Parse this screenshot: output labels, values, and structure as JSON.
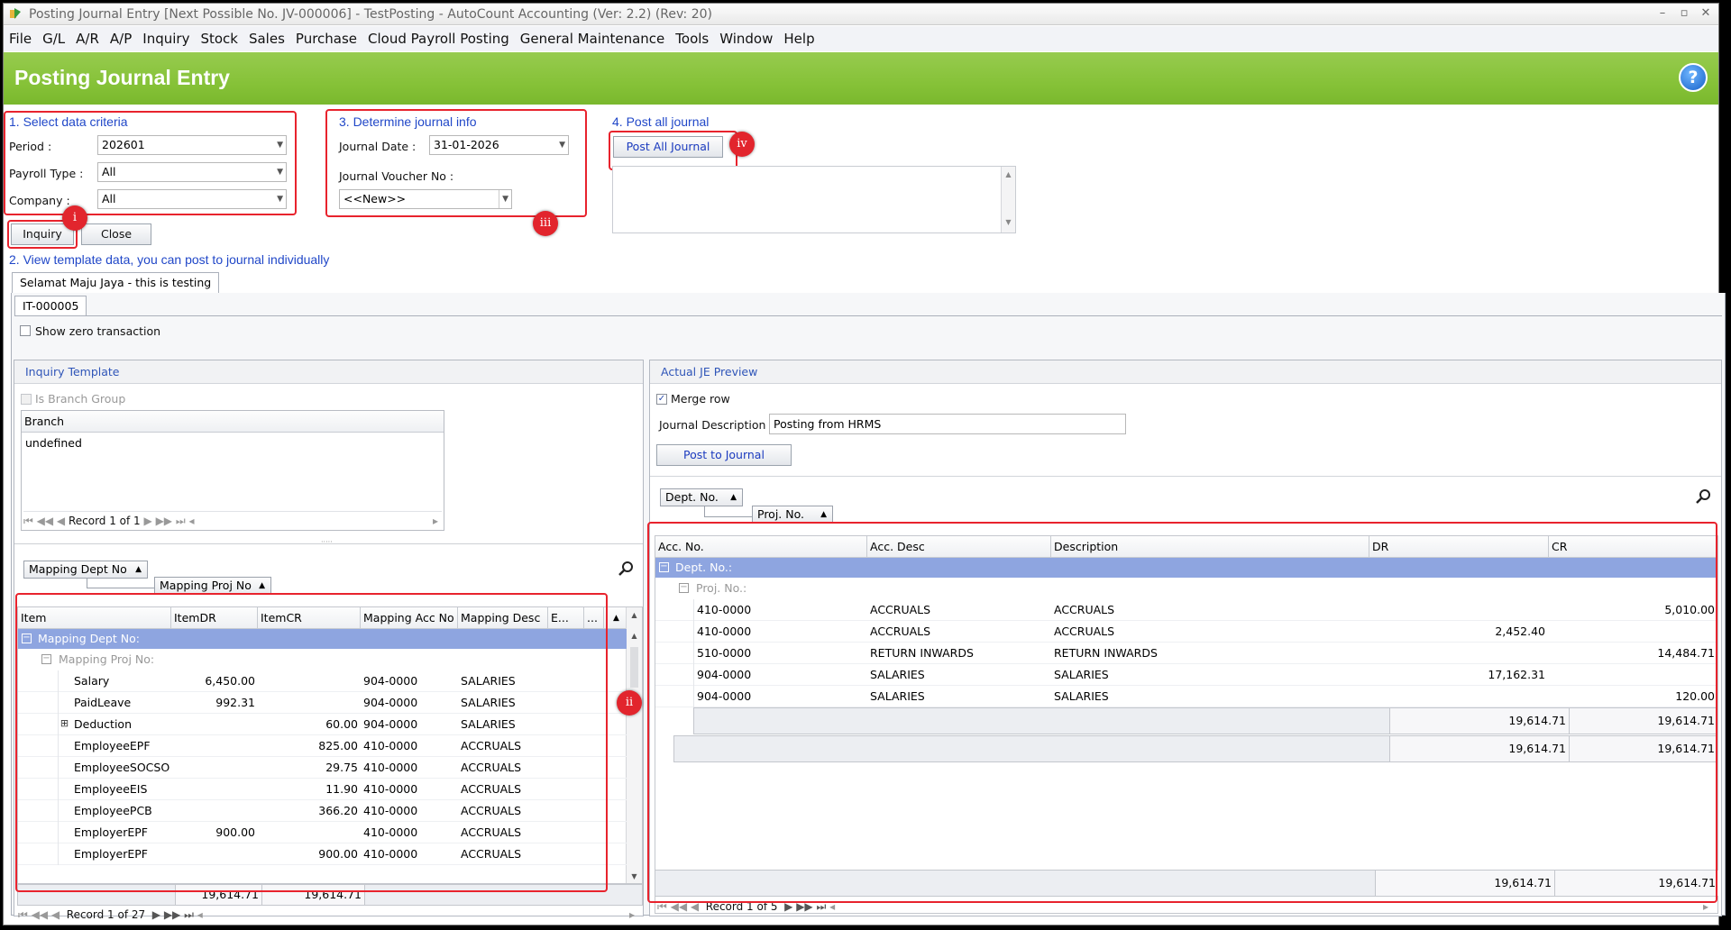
{
  "window": {
    "title": "Posting Journal Entry [Next Possible No. JV-000006] - TestPosting - AutoCount Accounting (Ver: 2.2) (Rev: 20)"
  },
  "menu": [
    "File",
    "G/L",
    "A/R",
    "A/P",
    "Inquiry",
    "Stock",
    "Sales",
    "Purchase",
    "Cloud Payroll Posting",
    "General Maintenance",
    "Tools",
    "Window",
    "Help"
  ],
  "banner": {
    "title": "Posting Journal Entry",
    "help": "?"
  },
  "step1": {
    "title": "1. Select data criteria",
    "period_label": "Period :",
    "period": "202601",
    "payroll_label": "Payroll Type :",
    "payroll": "All",
    "company_label": "Company :",
    "company": "All",
    "inquiry": "Inquiry",
    "close": "Close"
  },
  "step3": {
    "title": "3. Determine journal info",
    "date_label": "Journal Date :",
    "date": "31-01-2026",
    "voucher_label": "Journal Voucher No :",
    "voucher": "<<New>>"
  },
  "step4": {
    "title": "4. Post all journal",
    "post_all": "Post All Journal"
  },
  "step2": {
    "title": "2. View template data, you can post to journal individually"
  },
  "badges": {
    "i": "i",
    "ii": "ii",
    "iii": "iii",
    "iv": "iv"
  },
  "tabs": {
    "company_tab": "Selamat Maju Jaya - this is testing",
    "doc_tab": "IT-000005"
  },
  "show_zero": "Show zero transaction",
  "inquiry_template": {
    "title": "Inquiry Template",
    "is_branch": "Is Branch Group",
    "branch_header": "Branch",
    "branch_value": "undefined",
    "record": "Record 1 of 1"
  },
  "mapping": {
    "chip_dept": "Mapping Dept No",
    "chip_proj": "Mapping Proj No",
    "headers": [
      "Item",
      "ItemDR",
      "ItemCR",
      "Mapping Acc No",
      "Mapping Desc",
      "E...",
      "..."
    ],
    "group1": "Mapping Dept No:",
    "group2": "Mapping Proj No:",
    "rows": [
      {
        "item": "Salary",
        "dr": "6,450.00",
        "cr": "",
        "acc": "904-0000",
        "desc": "SALARIES"
      },
      {
        "item": "PaidLeave",
        "dr": "992.31",
        "cr": "",
        "acc": "904-0000",
        "desc": "SALARIES"
      },
      {
        "item": "Deduction",
        "dr": "",
        "cr": "60.00",
        "acc": "904-0000",
        "desc": "SALARIES",
        "expand": "+"
      },
      {
        "item": "EmployeeEPF",
        "dr": "",
        "cr": "825.00",
        "acc": "410-0000",
        "desc": "ACCRUALS"
      },
      {
        "item": "EmployeeSOCSO",
        "dr": "",
        "cr": "29.75",
        "acc": "410-0000",
        "desc": "ACCRUALS"
      },
      {
        "item": "EmployeeEIS",
        "dr": "",
        "cr": "11.90",
        "acc": "410-0000",
        "desc": "ACCRUALS"
      },
      {
        "item": "EmployeePCB",
        "dr": "",
        "cr": "366.20",
        "acc": "410-0000",
        "desc": "ACCRUALS"
      },
      {
        "item": "EmployerEPF",
        "dr": "900.00",
        "cr": "",
        "acc": "410-0000",
        "desc": "ACCRUALS"
      },
      {
        "item": "EmployerEPF",
        "dr": "",
        "cr": "900.00",
        "acc": "410-0000",
        "desc": "ACCRUALS"
      }
    ],
    "total_dr": "19,614.71",
    "total_cr": "19,614.71",
    "record": "Record 1 of 27"
  },
  "preview": {
    "title": "Actual JE Preview",
    "merge": "Merge row",
    "desc_label": "Journal Description :",
    "desc": "Posting from HRMS",
    "post": "Post to Journal",
    "chip_dept": "Dept. No.",
    "chip_proj": "Proj. No.",
    "headers": [
      "Acc. No.",
      "Acc. Desc",
      "Description",
      "DR",
      "CR"
    ],
    "group1": "Dept. No.:",
    "group2": "Proj. No.:",
    "rows": [
      {
        "acc": "410-0000",
        "accdesc": "ACCRUALS",
        "desc": "ACCRUALS",
        "dr": "",
        "cr": "5,010.00"
      },
      {
        "acc": "410-0000",
        "accdesc": "ACCRUALS",
        "desc": "ACCRUALS",
        "dr": "2,452.40",
        "cr": ""
      },
      {
        "acc": "510-0000",
        "accdesc": "RETURN INWARDS",
        "desc": "RETURN INWARDS",
        "dr": "",
        "cr": "14,484.71"
      },
      {
        "acc": "904-0000",
        "accdesc": "SALARIES",
        "desc": "SALARIES",
        "dr": "17,162.31",
        "cr": ""
      },
      {
        "acc": "904-0000",
        "accdesc": "SALARIES",
        "desc": "SALARIES",
        "dr": "",
        "cr": "120.00"
      }
    ],
    "sub_dr": "19,614.71",
    "sub_cr": "19,614.71",
    "grp_dr": "19,614.71",
    "grp_cr": "19,614.71",
    "tot_dr": "19,614.71",
    "tot_cr": "19,614.71",
    "record": "Record 1 of 5"
  }
}
